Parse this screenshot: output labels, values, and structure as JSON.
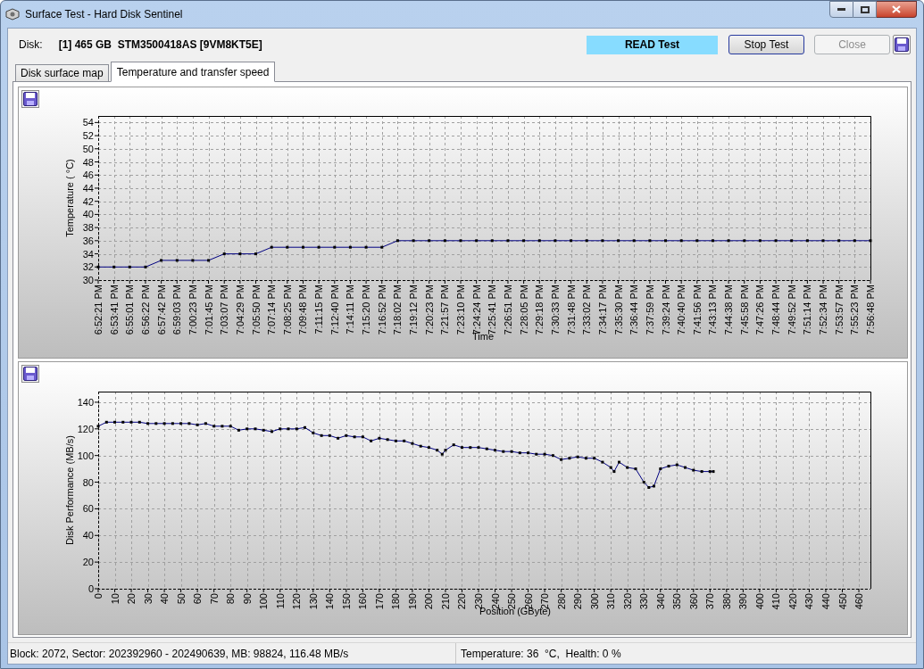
{
  "window": {
    "title": "Surface Test - Hard Disk Sentinel"
  },
  "header": {
    "disk_label": "Disk:",
    "disk_name": "[1] 465 GB  STM3500418AS [9VM8KT5E]",
    "test_status": "READ Test",
    "buttons": [
      {
        "label": "Stop Test",
        "disabled": false
      },
      {
        "label": "Close",
        "disabled": true
      }
    ]
  },
  "tabs": [
    {
      "label": "Disk surface map",
      "selected": false
    },
    {
      "label": "Temperature and transfer speed",
      "selected": true
    }
  ],
  "charts": [
    {
      "chart_data": {
        "type": "line",
        "xlabel": "Time",
        "ylabel": "Temperature ( °C)",
        "categories": [
          "6:52:21 PM",
          "6:53:41 PM",
          "6:55:01 PM",
          "6:56:22 PM",
          "6:57:42 PM",
          "6:59:03 PM",
          "7:00:23 PM",
          "7:01:45 PM",
          "7:03:07 PM",
          "7:04:29 PM",
          "7:05:50 PM",
          "7:07:14 PM",
          "7:08:25 PM",
          "7:09:48 PM",
          "7:11:15 PM",
          "7:12:40 PM",
          "7:14:11 PM",
          "7:15:20 PM",
          "7:16:52 PM",
          "7:18:02 PM",
          "7:19:12 PM",
          "7:20:23 PM",
          "7:21:57 PM",
          "7:23:10 PM",
          "7:24:24 PM",
          "7:25:41 PM",
          "7:26:51 PM",
          "7:28:05 PM",
          "7:29:18 PM",
          "7:30:33 PM",
          "7:31:48 PM",
          "7:33:02 PM",
          "7:34:17 PM",
          "7:35:30 PM",
          "7:36:44 PM",
          "7:37:59 PM",
          "7:39:24 PM",
          "7:40:40 PM",
          "7:41:56 PM",
          "7:43:13 PM",
          "7:44:38 PM",
          "7:45:58 PM",
          "7:47:26 PM",
          "7:48:44 PM",
          "7:49:52 PM",
          "7:51:14 PM",
          "7:52:34 PM",
          "7:53:57 PM",
          "7:55:23 PM",
          "7:56:48 PM"
        ],
        "grid": true,
        "series": [
          {
            "color": "#000080",
            "marker": "square",
            "values": [
              32,
              32,
              32,
              32,
              33,
              33,
              33,
              33,
              34,
              34,
              34,
              35,
              35,
              35,
              35,
              35,
              35,
              35,
              35,
              36,
              36,
              36,
              36,
              36,
              36,
              36,
              36,
              36,
              36,
              36,
              36,
              36,
              36,
              36,
              36,
              36,
              36,
              36,
              36,
              36,
              36,
              36,
              36,
              36,
              36,
              36,
              36,
              36,
              36,
              36
            ]
          }
        ],
        "ylim": [
          30,
          55
        ],
        "yticks": [
          30,
          32,
          34,
          36,
          38,
          40,
          42,
          44,
          46,
          48,
          50,
          52,
          54
        ]
      }
    },
    {
      "chart_data": {
        "type": "line",
        "xlabel": "Position (GByte)",
        "ylabel": "Disk Performance (MB/s)",
        "x": [
          0,
          5,
          10,
          15,
          20,
          25,
          30,
          35,
          40,
          45,
          50,
          55,
          60,
          65,
          70,
          75,
          80,
          85,
          90,
          95,
          100,
          105,
          110,
          115,
          120,
          125,
          130,
          135,
          140,
          145,
          150,
          155,
          160,
          165,
          170,
          175,
          180,
          185,
          190,
          195,
          200,
          205,
          208,
          210,
          215,
          220,
          225,
          230,
          235,
          240,
          245,
          250,
          255,
          260,
          265,
          270,
          275,
          280,
          285,
          290,
          295,
          300,
          305,
          310,
          312,
          315,
          320,
          325,
          330,
          333,
          336,
          340,
          345,
          350,
          355,
          360,
          365,
          370,
          372
        ],
        "grid": true,
        "series": [
          {
            "color": "#000080",
            "marker": "square",
            "values": [
              122,
              125,
              125,
              125,
              125,
              125,
              124,
              124,
              124,
              124,
              124,
              124,
              123,
              124,
              122,
              122,
              122,
              119,
              120,
              120,
              119,
              118,
              120,
              120,
              120,
              121,
              117,
              115,
              115,
              113,
              115,
              114,
              114,
              111,
              113,
              112,
              111,
              111,
              109,
              107,
              106,
              104,
              101,
              104,
              108,
              106,
              106,
              106,
              105,
              104,
              103,
              103,
              102,
              102,
              101,
              101,
              100,
              97,
              98,
              99,
              98,
              98,
              95,
              91,
              88,
              95,
              91,
              90,
              80,
              76,
              77,
              90,
              92,
              93,
              91,
              89,
              88,
              88,
              88
            ]
          }
        ],
        "xlim": [
          0,
          467
        ],
        "ylim": [
          0,
          148
        ],
        "xticks": [
          0,
          10,
          20,
          30,
          40,
          50,
          60,
          70,
          80,
          90,
          100,
          110,
          120,
          130,
          140,
          150,
          160,
          170,
          180,
          190,
          200,
          210,
          220,
          230,
          240,
          250,
          260,
          270,
          280,
          290,
          300,
          310,
          320,
          330,
          340,
          350,
          360,
          370,
          380,
          390,
          400,
          410,
          420,
          430,
          440,
          450,
          460
        ],
        "yticks": [
          0,
          20,
          40,
          60,
          80,
          100,
          120,
          140
        ]
      }
    }
  ],
  "status_bar": [
    "Block: 2072, Sector: 202392960 - 202490639, MB: 98824, 116.48 MB/s",
    "Temperature: 36  °C,  Health: 0 %"
  ]
}
